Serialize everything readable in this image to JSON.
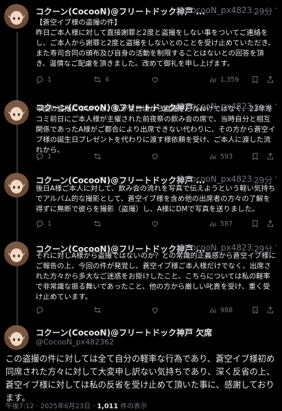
{
  "posts": [
    {
      "name": "コクーン(CocooN)@フリートドック神戸 ...",
      "handle": "@CocooN_px4823...",
      "time": "29分",
      "more": "···",
      "body": "【蒼空イブ様の盗撮の件】\n昨日ご本人様に対して直接謝罪と2度と盗撮をしない事をついてご連絡をし、ご本人から謝罪と2度と盗撮をしないとのことを受け止めていただき、また寿司合同の頒布及び自身の活動を制限することはないとの回答を頂き、温情なご配慮を頂きました。改めて御礼を申し上げます。",
      "replies": "1",
      "reposts": "4",
      "likes": "",
      "views": "1,359"
    },
    {
      "name": "コクーン(CocooN)@フリートドック神戸 ...",
      "handle": "@CocooN_px4823...",
      "time": "29分",
      "more": "···",
      "body": "今回の盗撮については、私が常日頃から盗撮をしたわけではなく、23年冬コミ前日にご本人様が主催された前夜祭の飲み会の席で、当時自分と相互関係であったA様がご都合により出席できない代わりに、その方から蒼空イブ様の誕生日プレゼントを代わりに渡す様依頼を受け、ご本人に渡した流れから、",
      "replies": "1",
      "reposts": "",
      "likes": "",
      "views": "593"
    },
    {
      "name": "コクーン(CocooN)@フリートドック神戸 ...",
      "handle": "@CocooN_px4823...",
      "time": "29分",
      "more": "···",
      "body": "後日A様ご本人に対して、飲み会の流れを写真で伝えようという軽い気持ちでアルバム的な撮影として、蒼空イブ様を含め他の出席者の方々の了解を得ずに無断で彼らを撮影（盗撮）し、A様にDMで写真を送りました。",
      "replies": "1",
      "reposts": "",
      "likes": "",
      "views": "587"
    },
    {
      "name": "コクーン(CocooN)@フリートドック神戸 ...",
      "handle": "@CocooN_px4823...",
      "time": "29分",
      "more": "···",
      "body": "それに対しA様から盗撮ではないのか？との常識的正義感から蒼空イブ様にご報告の上、今回の件が発覚し、蒼空イブ様ご本人様だけでなく、出席された方々から多大なご迷惑をお掛けしたこと、こちらについては私の軽率で非常識な振る舞いであったこと、他の方から厳しい叱責を受け、重く受け止めています。",
      "replies": "",
      "reposts": "",
      "likes": "",
      "views": "988"
    }
  ],
  "main_post": {
    "name": "コクーン(CocooN)@フリートドック神戸 欠席",
    "handle": "@CocooN_px482362",
    "body": "この盗撮の件に対しては全て自分の軽率な行為であり、蒼空イブ様初め同席された方々に対して大変申し訳ない気持ちであり、深く反省の上、蒼空イブ様に対しては私の反省を受け止めて頂いた事に、感謝しております。",
    "timestamp": "午後7:12 · 2025年6月23日 · ",
    "views_count": "1,011",
    "views_label": " 件の表示"
  },
  "colors": {
    "background": "#000000",
    "text": "#e7e9ea",
    "muted": "#71767b",
    "thread_line": "#333639"
  }
}
